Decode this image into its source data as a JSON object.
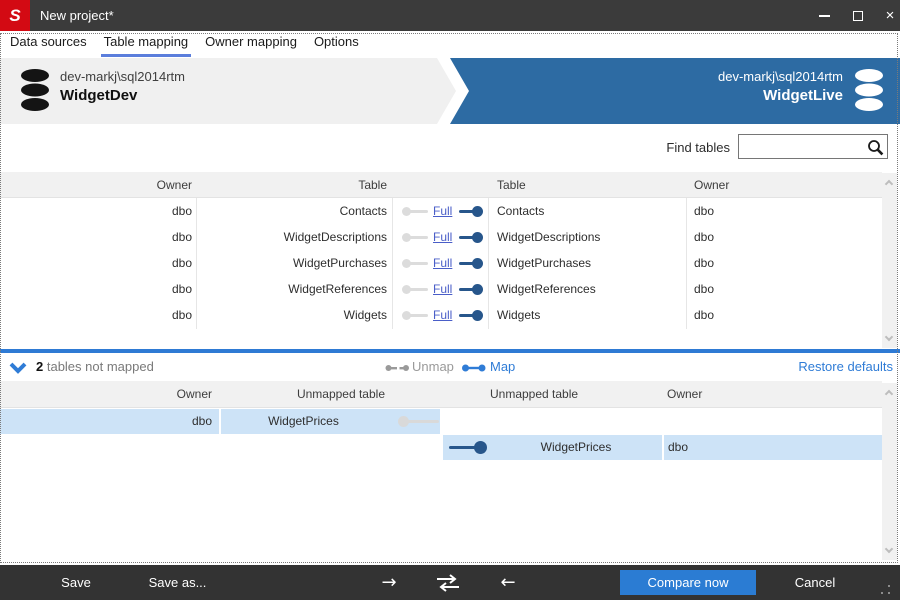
{
  "titlebar": {
    "title": "New project*",
    "app_glyph": "S"
  },
  "tabs": {
    "items": [
      {
        "label": "Data sources"
      },
      {
        "label": "Table mapping"
      },
      {
        "label": "Owner mapping"
      },
      {
        "label": "Options"
      }
    ],
    "active": "Table mapping"
  },
  "databases": {
    "source": {
      "server": "dev-markj\\sql2014rtm",
      "name": "WidgetDev"
    },
    "target": {
      "server": "dev-markj\\sql2014rtm",
      "name": "WidgetLive"
    }
  },
  "search": {
    "label": "Find tables",
    "value": ""
  },
  "mapped_grid": {
    "headers": {
      "owner_left": "Owner",
      "table_left": "Table",
      "table_right": "Table",
      "owner_right": "Owner"
    },
    "rows": [
      {
        "owner_left": "dbo",
        "table_left": "Contacts",
        "mapping": "Full",
        "table_right": "Contacts",
        "owner_right": "dbo"
      },
      {
        "owner_left": "dbo",
        "table_left": "WidgetDescriptions",
        "mapping": "Full",
        "table_right": "WidgetDescriptions",
        "owner_right": "dbo"
      },
      {
        "owner_left": "dbo",
        "table_left": "WidgetPurchases",
        "mapping": "Full",
        "table_right": "WidgetPurchases",
        "owner_right": "dbo"
      },
      {
        "owner_left": "dbo",
        "table_left": "WidgetReferences",
        "mapping": "Full",
        "table_right": "WidgetReferences",
        "owner_right": "dbo"
      },
      {
        "owner_left": "dbo",
        "table_left": "Widgets",
        "mapping": "Full",
        "table_right": "Widgets",
        "owner_right": "dbo"
      }
    ]
  },
  "unmapped_bar": {
    "count": "2",
    "label": " tables not mapped",
    "unmap_label": "Unmap",
    "map_label": "Map",
    "restore_label": "Restore defaults"
  },
  "unmapped_grid": {
    "headers": {
      "owner_left": "Owner",
      "table_left": "Unmapped table",
      "table_right": "Unmapped table",
      "owner_right": "Owner"
    },
    "left_row": {
      "owner": "dbo",
      "table": "WidgetPrices"
    },
    "right_row": {
      "table": "WidgetPrices",
      "owner": "dbo"
    }
  },
  "toolbar": {
    "save": "Save",
    "save_as": "Save as...",
    "arrow_right": "→",
    "arrow_left": "←",
    "compare": "Compare now",
    "cancel": "Cancel"
  },
  "colors": {
    "accent_blue": "#2f7cd6",
    "panel_blue": "#2d6ba3",
    "brand_red": "#d30a13",
    "selection_blue": "#cde3f7",
    "toggle_navy": "#27568b"
  }
}
